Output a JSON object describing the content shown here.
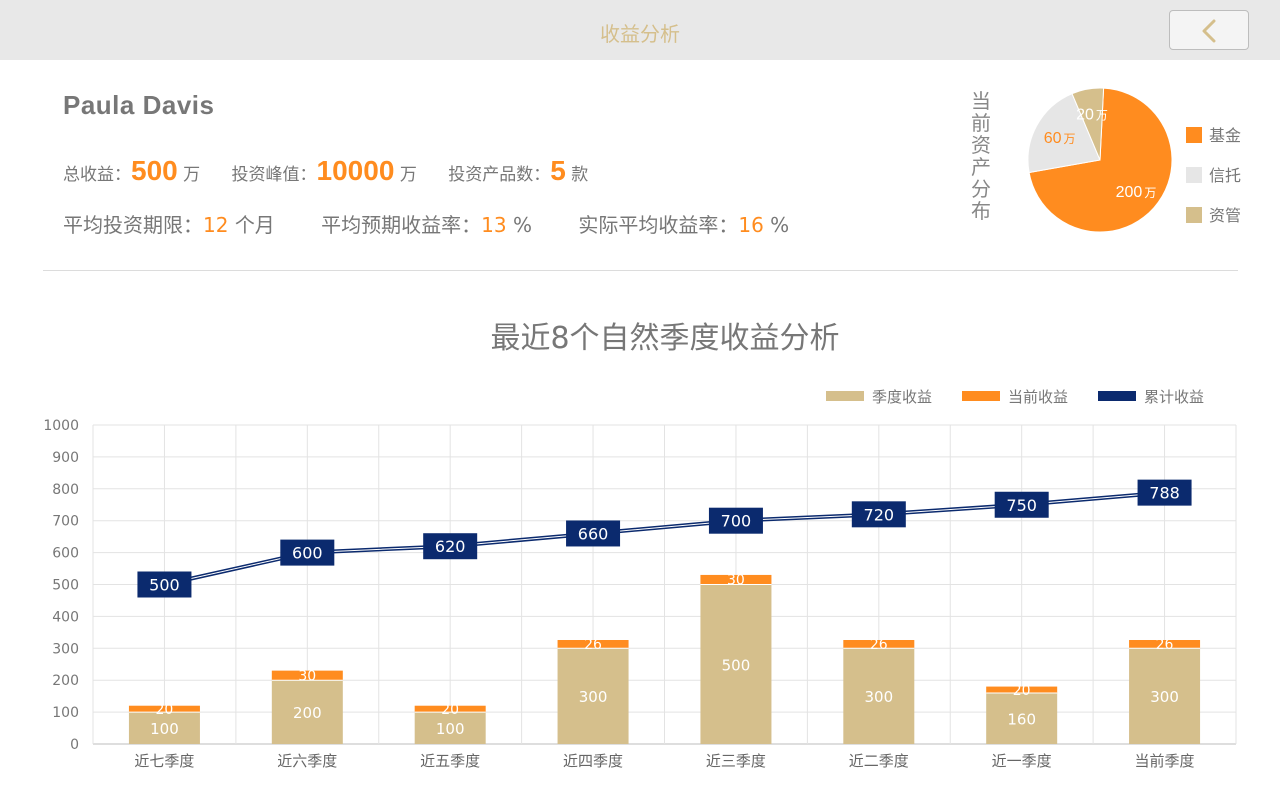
{
  "header": {
    "title": "收益分析",
    "back_icon": "chevron-left-icon"
  },
  "user": {
    "name": "Paula Davis"
  },
  "summary": {
    "total_label": "总收益：",
    "total_value": "500",
    "total_unit": "万",
    "peak_label": "投资峰值：",
    "peak_value": "10000",
    "peak_unit": "万",
    "products_label": "投资产品数：",
    "products_value": "5",
    "products_unit": "款",
    "avg_term_label": "平均投资期限：",
    "avg_term_value": "12",
    "avg_term_unit": "个月",
    "expected_label": "平均预期收益率：",
    "expected_value": "13",
    "expected_unit": "%",
    "actual_label": "实际平均收益率：",
    "actual_value": "16",
    "actual_unit": "%"
  },
  "asset_pie": {
    "title": "当前资产分布",
    "unit": "万",
    "slices": [
      {
        "name": "基金",
        "value": 200,
        "label": "200",
        "color": "#ff8c1f"
      },
      {
        "name": "信托",
        "value": 60,
        "label": "60",
        "color": "#e6e6e6"
      },
      {
        "name": "资管",
        "value": 20,
        "label": "20",
        "color": "#d5bf8c"
      }
    ]
  },
  "chart_data": {
    "type": "bar",
    "title": "最近8个自然季度收益分析",
    "categories": [
      "近七季度",
      "近六季度",
      "近五季度",
      "近四季度",
      "近三季度",
      "近二季度",
      "近一季度",
      "当前季度"
    ],
    "ylim": [
      0,
      1000
    ],
    "yticks": [
      "0",
      "100",
      "200",
      "300",
      "400",
      "500",
      "600",
      "700",
      "800",
      "900",
      "1000"
    ],
    "grid": true,
    "legend_position": "top-right",
    "stacked": true,
    "series": [
      {
        "name": "季度收益",
        "type": "bar",
        "color": "#d5bf8c",
        "values": [
          100,
          200,
          100,
          300,
          500,
          300,
          160,
          300
        ]
      },
      {
        "name": "当前收益",
        "type": "bar",
        "color": "#ff8c1f",
        "values": [
          20,
          30,
          20,
          26,
          30,
          26,
          20,
          26
        ]
      },
      {
        "name": "累计收益",
        "type": "line",
        "color": "#0b2a6e",
        "values": [
          500,
          600,
          620,
          660,
          700,
          720,
          750,
          788
        ]
      }
    ]
  }
}
